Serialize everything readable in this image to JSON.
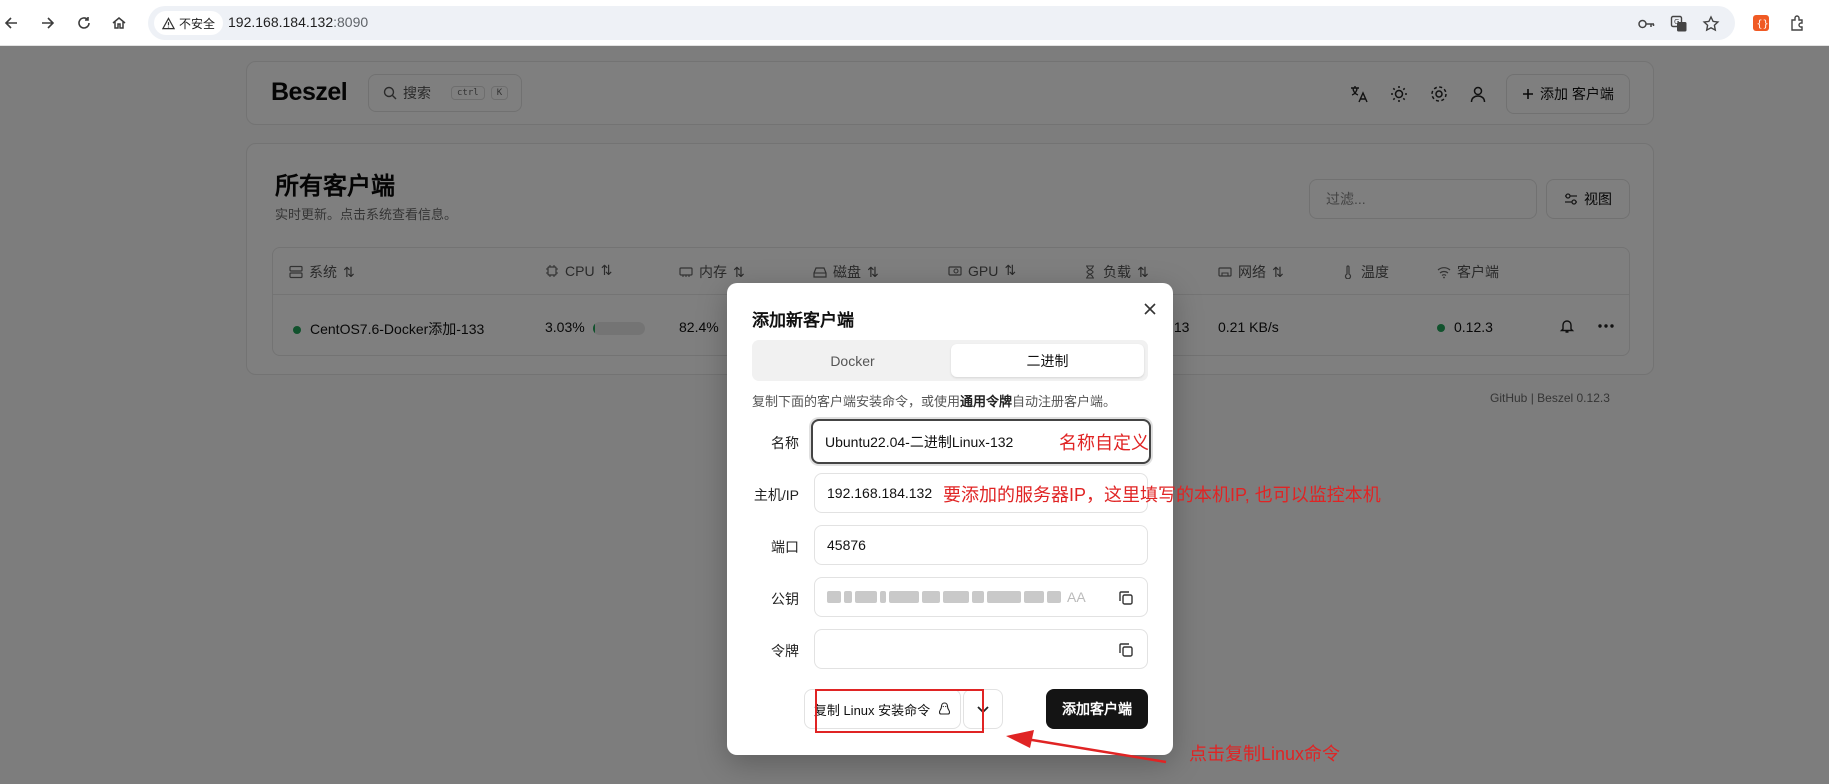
{
  "browser": {
    "security_label": "不安全",
    "url_host": "192.168.184.132",
    "url_port": ":8090"
  },
  "app": {
    "logo": "Beszel",
    "search": {
      "label": "搜索",
      "kbd_ctrl": "ctrl",
      "kbd_k": "K"
    },
    "add_client_label": "添加 客户端",
    "clients": {
      "title": "所有客户端",
      "subtitle": "实时更新。点击系统查看信息。",
      "filter_placeholder": "过滤...",
      "view_label": "视图",
      "columns": [
        "系统",
        "CPU",
        "内存",
        "磁盘",
        "GPU",
        "负载",
        "网络",
        "温度",
        "客户端"
      ],
      "row": {
        "name": "CentOS7.6-Docker添加-133",
        "cpu": "3.03%",
        "cpu_fraction": 0.0303,
        "memory": "82.4%",
        "load_partial": ".13",
        "network": "0.21 KB/s",
        "agent_version": "0.12.3"
      }
    },
    "footer": {
      "github": "GitHub",
      "version": "Beszel 0.12.3"
    }
  },
  "modal": {
    "title": "添加新客户端",
    "tabs": [
      "Docker",
      "二进制"
    ],
    "active_tab": "二进制",
    "description_pre": "复制下面的客户端安装命令，或使用",
    "description_bold": "通用令牌",
    "description_post": "自动注册客户端。",
    "fields": {
      "name": {
        "label": "名称",
        "value": "Ubuntu22.04-二进制Linux-132"
      },
      "host": {
        "label": "主机/IP",
        "value": "192.168.184.132"
      },
      "port": {
        "label": "端口",
        "value": "45876"
      },
      "public_key": {
        "label": "公钥",
        "tail": "AA"
      },
      "token": {
        "label": "令牌",
        "value": ""
      }
    },
    "copy_command_label": "复制 Linux 安装命令",
    "submit_label": "添加客户端"
  },
  "annotations": {
    "name_note": "名称自定义",
    "ip_note": "要添加的服务器IP，这里填写的本机IP, 也可以监控本机",
    "copy_note": "点击复制Linux命令",
    "color": "#e02424"
  }
}
